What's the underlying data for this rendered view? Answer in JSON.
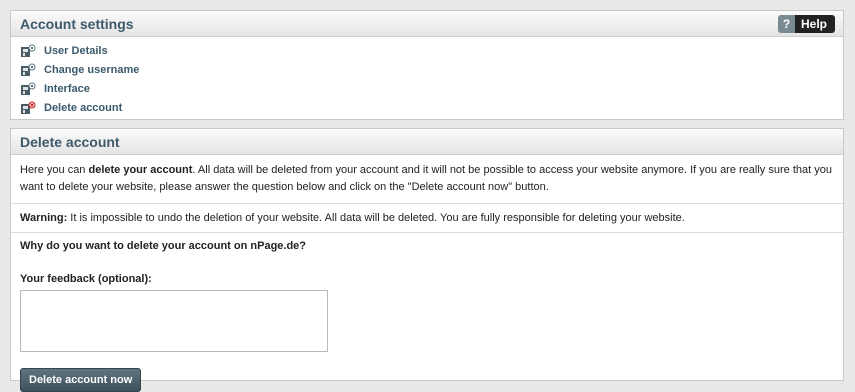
{
  "account_settings": {
    "title": "Account settings",
    "help": {
      "icon_glyph": "?",
      "label": "Help"
    },
    "menu": [
      {
        "label": "User Details",
        "icon": "user-settings-icon"
      },
      {
        "label": "Change username",
        "icon": "user-settings-icon"
      },
      {
        "label": "Interface",
        "icon": "user-settings-icon"
      },
      {
        "label": "Delete account",
        "icon": "user-delete-icon"
      }
    ]
  },
  "delete_account": {
    "title": "Delete account",
    "intro": {
      "prefix": "Here you can ",
      "bold": "delete your account",
      "suffix": ". All data will be deleted from your account and it will not be possible to access your website anymore. If you are really sure that you want to delete your website, please answer the question below and click on the \"Delete account now\" button."
    },
    "warning": {
      "label": "Warning:",
      "text": " It is impossible to undo the deletion of your website. All data will be deleted. You are fully responsible for deleting your website."
    },
    "question": "Why do you want to delete your account on nPage.de?",
    "feedback_label": "Your feedback (optional):",
    "feedback_value": "",
    "button_label": "Delete account now"
  },
  "colors": {
    "title_text": "#3d5a6b",
    "link_text": "#3b5a6d",
    "button_bg": "#4e626d",
    "delete_icon_accent": "#cc2222"
  }
}
